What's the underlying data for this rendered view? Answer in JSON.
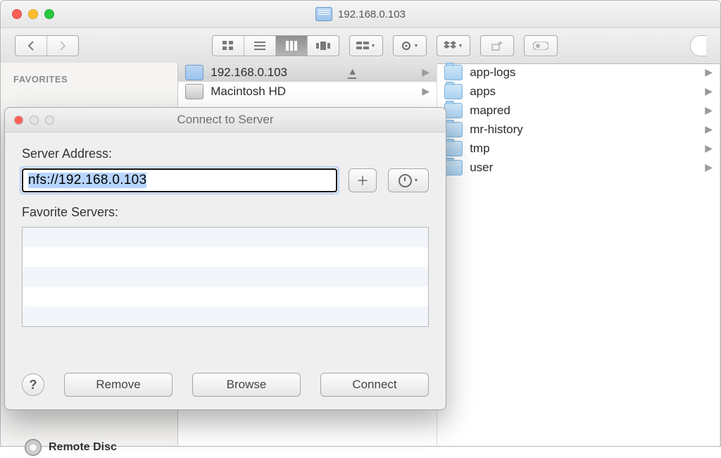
{
  "window": {
    "title": "192.168.0.103",
    "sidebar": {
      "section_label": "FAVORITES",
      "remote_disc": "Remote Disc"
    },
    "col1": [
      {
        "icon": "server",
        "label": "192.168.0.103",
        "selected": true,
        "ejectable": true
      },
      {
        "icon": "hd",
        "label": "Macintosh HD",
        "selected": false,
        "ejectable": false
      }
    ],
    "col2": [
      {
        "label": "app-logs"
      },
      {
        "label": "apps"
      },
      {
        "label": "mapred"
      },
      {
        "label": "mr-history"
      },
      {
        "label": "tmp"
      },
      {
        "label": "user"
      }
    ]
  },
  "dialog": {
    "title": "Connect to Server",
    "server_address_label": "Server Address:",
    "server_address": "nfs://192.168.0.103",
    "favorite_servers_label": "Favorite Servers:",
    "buttons": {
      "remove": "Remove",
      "browse": "Browse",
      "connect": "Connect"
    }
  }
}
